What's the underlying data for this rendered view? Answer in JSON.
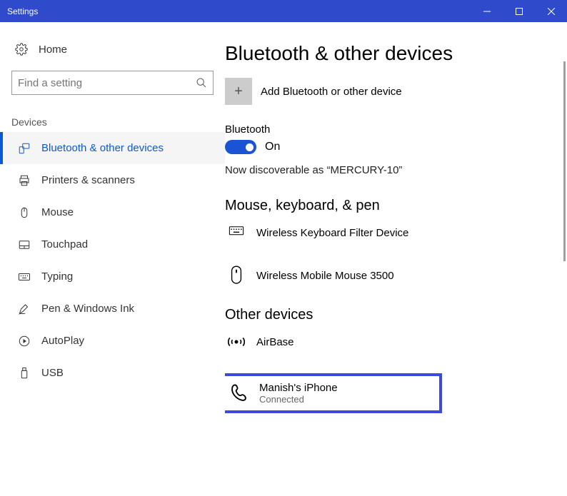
{
  "window": {
    "title": "Settings"
  },
  "sidebar": {
    "home": "Home",
    "search_placeholder": "Find a setting",
    "group": "Devices",
    "items": [
      {
        "label": "Bluetooth & other devices"
      },
      {
        "label": "Printers & scanners"
      },
      {
        "label": "Mouse"
      },
      {
        "label": "Touchpad"
      },
      {
        "label": "Typing"
      },
      {
        "label": "Pen & Windows Ink"
      },
      {
        "label": "AutoPlay"
      },
      {
        "label": "USB"
      }
    ]
  },
  "main": {
    "title": "Bluetooth & other devices",
    "add_label": "Add Bluetooth or other device",
    "bt_label": "Bluetooth",
    "toggle_state": "On",
    "discoverable": "Now discoverable as “MERCURY-10”",
    "cat1": "Mouse, keyboard, & pen",
    "dev1": "Wireless Keyboard Filter Device",
    "dev2": "Wireless Mobile Mouse 3500",
    "cat2": "Other devices",
    "dev3": "AirBase",
    "dev4_name": "Manish's iPhone",
    "dev4_status": "Connected"
  }
}
